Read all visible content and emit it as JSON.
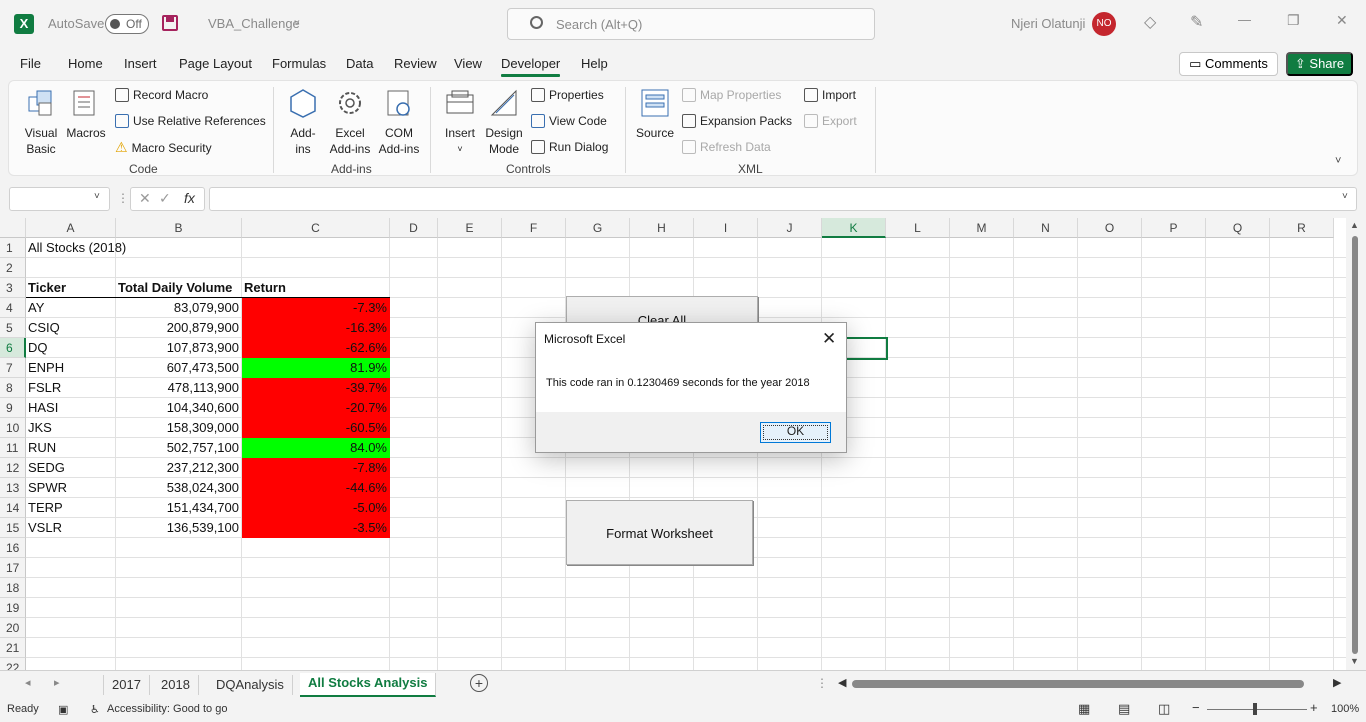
{
  "titlebar": {
    "app_logo": "X",
    "autosave_label": "AutoSave",
    "autosave_state": "Off",
    "doc_name": "VBA_Challenge",
    "doc_caret": "˅",
    "search_placeholder": "Search (Alt+Q)",
    "user_name": "Njeri Olatunji",
    "user_initials": "NO",
    "minimize": "—",
    "restore": "❐",
    "close": "✕"
  },
  "ribbon_tabs": [
    "File",
    "Home",
    "Insert",
    "Page Layout",
    "Formulas",
    "Data",
    "Review",
    "View",
    "Developer",
    "Help"
  ],
  "active_tab": "Developer",
  "actions": {
    "comments": "Comments",
    "share": "Share"
  },
  "ribbon": {
    "code": {
      "label": "Code",
      "visual_basic": "Visual Basic",
      "macros": "Macros",
      "record_macro": "Record Macro",
      "relative_refs": "Use Relative References",
      "macro_security": "Macro Security"
    },
    "addins": {
      "label": "Add-ins",
      "addins": "Add-ins",
      "excel_addins": "Excel Add-ins",
      "com_addins": "COM Add-ins"
    },
    "controls": {
      "label": "Controls",
      "insert": "Insert",
      "design_mode": "Design Mode",
      "properties": "Properties",
      "view_code": "View Code",
      "run_dialog": "Run Dialog"
    },
    "xml": {
      "label": "XML",
      "source": "Source",
      "map_properties": "Map Properties",
      "expansion_packs": "Expansion Packs",
      "refresh_data": "Refresh Data",
      "import": "Import",
      "export": "Export"
    }
  },
  "formula_bar": {
    "name_box": "",
    "fx": "fx",
    "formula": ""
  },
  "columns": [
    "A",
    "B",
    "C",
    "D",
    "E",
    "F",
    "G",
    "H",
    "I",
    "J",
    "K",
    "L",
    "M",
    "N",
    "O",
    "P",
    "Q",
    "R"
  ],
  "selected_column": "K",
  "rows": [
    "1",
    "2",
    "3",
    "4",
    "5",
    "6",
    "7",
    "8",
    "9",
    "10",
    "11",
    "12",
    "13",
    "14",
    "15",
    "16",
    "17",
    "18",
    "19",
    "20",
    "21",
    "22"
  ],
  "selected_row": "6",
  "sheet": {
    "title": "All Stocks (2018)",
    "headers": [
      "Ticker",
      "Total Daily Volume",
      "Return"
    ],
    "data": [
      {
        "ticker": "AY",
        "volume": "83,079,900",
        "ret": "-7.3%",
        "positive": false
      },
      {
        "ticker": "CSIQ",
        "volume": "200,879,900",
        "ret": "-16.3%",
        "positive": false
      },
      {
        "ticker": "DQ",
        "volume": "107,873,900",
        "ret": "-62.6%",
        "positive": false
      },
      {
        "ticker": "ENPH",
        "volume": "607,473,500",
        "ret": "81.9%",
        "positive": true
      },
      {
        "ticker": "FSLR",
        "volume": "478,113,900",
        "ret": "-39.7%",
        "positive": false
      },
      {
        "ticker": "HASI",
        "volume": "104,340,600",
        "ret": "-20.7%",
        "positive": false
      },
      {
        "ticker": "JKS",
        "volume": "158,309,000",
        "ret": "-60.5%",
        "positive": false
      },
      {
        "ticker": "RUN",
        "volume": "502,757,100",
        "ret": "84.0%",
        "positive": true
      },
      {
        "ticker": "SEDG",
        "volume": "237,212,300",
        "ret": "-7.8%",
        "positive": false
      },
      {
        "ticker": "SPWR",
        "volume": "538,024,300",
        "ret": "-44.6%",
        "positive": false
      },
      {
        "ticker": "TERP",
        "volume": "151,434,700",
        "ret": "-5.0%",
        "positive": false
      },
      {
        "ticker": "VSLR",
        "volume": "136,539,100",
        "ret": "-3.5%",
        "positive": false
      }
    ]
  },
  "buttons": {
    "clear_all": "Clear All",
    "format_worksheet": "Format Worksheet"
  },
  "dialog": {
    "title": "Microsoft Excel",
    "message": "This code ran in 0.1230469 seconds for the year 2018",
    "ok": "OK",
    "close": "✕"
  },
  "sheet_tabs": [
    "2017",
    "2018",
    "DQAnalysis",
    "All Stocks Analysis"
  ],
  "active_sheet": "All Stocks Analysis",
  "status": {
    "ready": "Ready",
    "accessibility": "Accessibility: Good to go",
    "zoom": "100%"
  },
  "colors": {
    "accent": "#107c41",
    "negative": "#ff0000",
    "positive": "#00ff00"
  }
}
